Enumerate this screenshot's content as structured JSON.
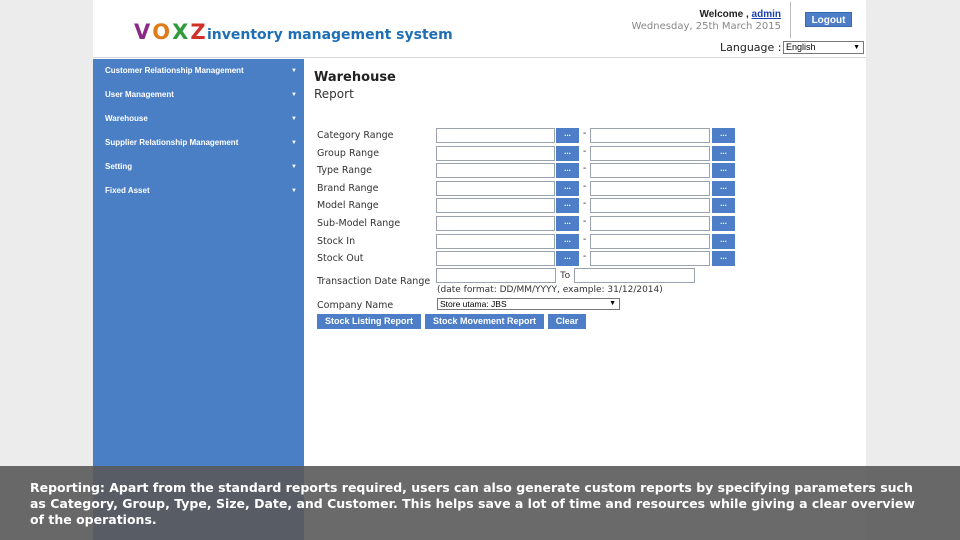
{
  "logo": {
    "letters": [
      "V",
      "O",
      "X",
      "Z"
    ],
    "colors": [
      "#8b2a86",
      "#e07b1a",
      "#2f9a3a",
      "#d0302a"
    ]
  },
  "header": {
    "app_title": "inventory management system",
    "welcome_prefix": "Welcome ,",
    "username": "admin",
    "date": "Wednesday, 25th March 2015",
    "logout_label": "Logout",
    "language_label": "Language :",
    "language_value": "English"
  },
  "sidebar": {
    "items": [
      {
        "label": "Customer Relationship Management"
      },
      {
        "label": "User Management"
      },
      {
        "label": "Warehouse"
      },
      {
        "label": "Supplier Relationship Management"
      },
      {
        "label": "Setting"
      },
      {
        "label": "Fixed Asset"
      }
    ],
    "chevron": "▼"
  },
  "main": {
    "title": "Warehouse",
    "subtitle": "Report",
    "ranges": [
      {
        "label": "Category Range"
      },
      {
        "label": "Group Range"
      },
      {
        "label": "Type Range"
      },
      {
        "label": "Brand Range"
      },
      {
        "label": "Model Range"
      },
      {
        "label": "Sub-Model Range"
      },
      {
        "label": "Stock In"
      },
      {
        "label": "Stock Out"
      }
    ],
    "lookup_label": "...",
    "dash": "-",
    "date_range_label": "Transaction Date Range",
    "to_label": "To",
    "date_hint": "(date format: DD/MM/YYYY, example: 31/12/2014)",
    "company_label": "Company Name",
    "company_value": "Store utama: JBS",
    "buttons": {
      "stock_listing": "Stock Listing Report",
      "stock_movement": "Stock Movement Report",
      "clear": "Clear"
    }
  },
  "caption": "Reporting: Apart from the standard reports required, users can also generate custom reports by specifying parameters such as Category, Group, Type, Size, Date, and Customer. This helps save a lot of time and resources while giving a clear overview of the operations.",
  "colors": {
    "accent": "#4d7ec7",
    "sidebar": "#4a7fc6",
    "title_blue": "#1f6fb5"
  }
}
